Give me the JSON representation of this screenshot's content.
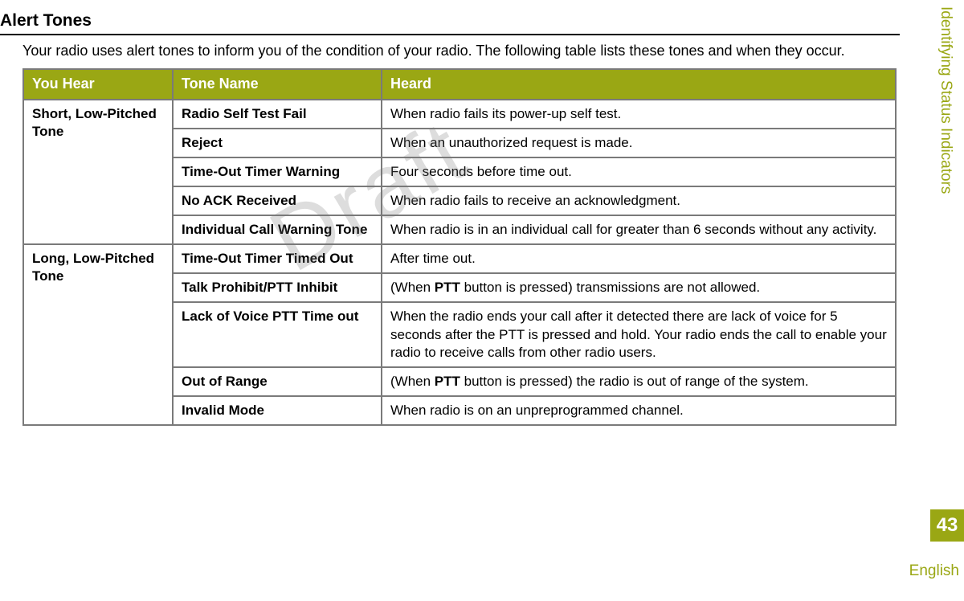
{
  "section_title": "Alert Tones",
  "intro_text": "Your radio uses alert tones to inform you of the condition of your radio. The following table lists these tones and when they occur.",
  "watermark": "Draft",
  "side_tab": "Identifying Status Indicators",
  "page_number": "43",
  "footer_language": "English",
  "table": {
    "headers": {
      "you_hear": "You Hear",
      "tone_name": "Tone Name",
      "heard": "Heard"
    },
    "groups": [
      {
        "you_hear": "Short, Low-Pitched Tone",
        "rows": [
          {
            "tone_name": "Radio Self Test Fail",
            "heard_parts": [
              {
                "t": "When radio fails its power-up self test."
              }
            ]
          },
          {
            "tone_name": "Reject",
            "heard_parts": [
              {
                "t": "When an unauthorized request is made."
              }
            ]
          },
          {
            "tone_name": "Time-Out Timer Warning",
            "heard_parts": [
              {
                "t": "Four seconds before time out."
              }
            ]
          },
          {
            "tone_name": "No ACK Received",
            "heard_parts": [
              {
                "t": "When radio fails to receive an acknowledgment."
              }
            ]
          },
          {
            "tone_name": "Individual Call Warning Tone",
            "heard_parts": [
              {
                "t": "When radio is in an individual call for greater than 6 seconds without any activity."
              }
            ]
          }
        ]
      },
      {
        "you_hear": "Long, Low-Pitched Tone",
        "rows": [
          {
            "tone_name": "Time-Out Timer Timed Out",
            "heard_parts": [
              {
                "t": "After time out."
              }
            ]
          },
          {
            "tone_name": "Talk Prohibit/PTT Inhibit",
            "heard_parts": [
              {
                "t": "(When "
              },
              {
                "t": "PTT",
                "b": true
              },
              {
                "t": " button is pressed) transmissions are not allowed."
              }
            ]
          },
          {
            "tone_name": "Lack of Voice PTT Time out",
            "heard_parts": [
              {
                "t": "When the radio ends your call after it detected there are lack of voice for 5 seconds after the PTT is pressed and hold. Your radio ends the call to enable your radio to receive calls from other radio users."
              }
            ]
          },
          {
            "tone_name": "Out of Range",
            "heard_parts": [
              {
                "t": "(When "
              },
              {
                "t": "PTT",
                "b": true
              },
              {
                "t": " button is pressed) the radio is out of range of the system."
              }
            ]
          },
          {
            "tone_name": "Invalid Mode",
            "heard_parts": [
              {
                "t": "When radio is on an unpreprogrammed channel."
              }
            ]
          }
        ]
      }
    ]
  }
}
